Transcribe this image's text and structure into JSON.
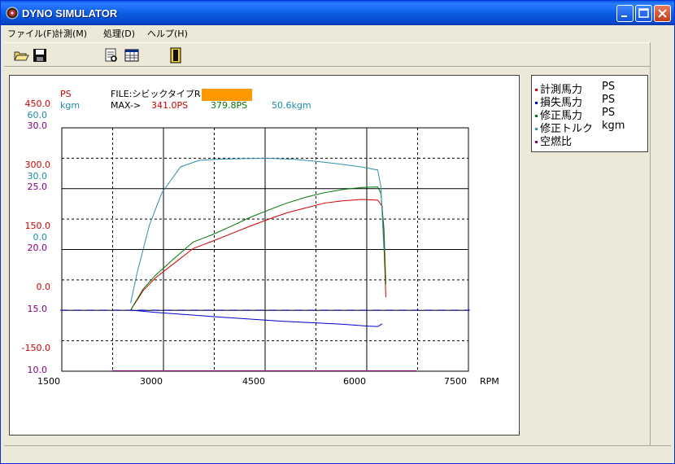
{
  "window": {
    "title": "DYNO SIMULATOR",
    "icon": "dyno-app-icon",
    "controls": [
      "minimize-icon",
      "maximize-icon",
      "close-icon"
    ]
  },
  "menu": [
    {
      "label": "ファイル(F)"
    },
    {
      "label": "計測(M)"
    },
    {
      "label": "処理(D)"
    },
    {
      "label": "ヘルプ(H)"
    }
  ],
  "toolbar": [
    "open-folder-icon",
    "save-disk-icon",
    "print-preview-icon",
    "data-table-icon",
    "exit-door-icon"
  ],
  "chart_header": {
    "unit_ps": "PS",
    "unit_kgm": "kgm",
    "file_label": "FILE:シビックタイプR",
    "max_label": "MAX->",
    "max_measured_ps": "341.0PS",
    "max_corrected_ps": "379.8PS",
    "max_torque": "50.6kgm",
    "redacted_color": "#ff9900"
  },
  "axis_labels": {
    "red": [
      "450.0",
      "300.0",
      "150.0",
      "0.0",
      "-150.0"
    ],
    "teal": [
      "60.0",
      "30.0",
      "0.0"
    ],
    "purple": [
      "30.0",
      "25.0",
      "20.0",
      "15.0",
      "10.0"
    ],
    "x_ticks": [
      "1500",
      "3000",
      "4500",
      "6000",
      "7500"
    ],
    "x_unit": "RPM"
  },
  "colors": {
    "measured": "#cc0000",
    "loss": "#0000cc",
    "corrected": "#007700",
    "torque": "#2f8fa8",
    "afr": "#800080",
    "teal_label": "#1a8aa8",
    "purple_label": "#800080"
  },
  "legend": [
    {
      "label": "計測馬力",
      "unit": "PS",
      "color": "#cc0000"
    },
    {
      "label": "損失馬力",
      "unit": "PS",
      "color": "#0000cc"
    },
    {
      "label": "修正馬力",
      "unit": "PS",
      "color": "#007700"
    },
    {
      "label": "修正トルク",
      "unit": "kgm",
      "color": "#2f8fa8"
    },
    {
      "label": "空燃比",
      "unit": "",
      "color": "#800080"
    }
  ],
  "chart_data": {
    "type": "line",
    "x_label": "RPM",
    "xlim": [
      1500,
      8000
    ],
    "grid": true,
    "series": [
      {
        "name": "計測馬力",
        "unit": "PS",
        "axis": "ps",
        "x": [
          2600,
          2800,
          3000,
          3300,
          3600,
          3900,
          4200,
          4500,
          4800,
          5100,
          5400,
          5700,
          6000,
          6300,
          6550,
          6620,
          6650,
          6680
        ],
        "y": [
          0,
          60,
          100,
          145,
          190,
          212,
          235,
          258,
          280,
          300,
          315,
          330,
          337,
          341,
          339,
          320,
          200,
          40
        ]
      },
      {
        "name": "損失馬力",
        "unit": "PS",
        "axis": "ps",
        "x": [
          2600,
          3000,
          4000,
          5000,
          6000,
          6400,
          6550,
          6620
        ],
        "y": [
          0,
          -10,
          -30,
          -48,
          -62,
          -70,
          -72,
          -60
        ]
      },
      {
        "name": "修正馬力",
        "unit": "PS",
        "axis": "ps",
        "x": [
          2600,
          2800,
          3000,
          3300,
          3600,
          3900,
          4200,
          4500,
          4800,
          5100,
          5400,
          5700,
          6000,
          6300,
          6550,
          6600,
          6650,
          6680
        ],
        "y": [
          0,
          65,
          108,
          160,
          210,
          232,
          258,
          285,
          308,
          330,
          348,
          362,
          372,
          378,
          379.8,
          360,
          250,
          80
        ]
      },
      {
        "name": "修正トルク",
        "unit": "kgm",
        "axis": "kgm",
        "x": [
          2600,
          2700,
          2900,
          3100,
          3400,
          3700,
          4000,
          4400,
          4800,
          5200,
          5600,
          6000,
          6300,
          6550,
          6600,
          6650
        ],
        "y": [
          6,
          15,
          30,
          40,
          48,
          50,
          50.3,
          50.5,
          50.6,
          50.3,
          49.6,
          48.7,
          47.9,
          47,
          42,
          22
        ]
      }
    ],
    "afr_reference": 15.0
  }
}
